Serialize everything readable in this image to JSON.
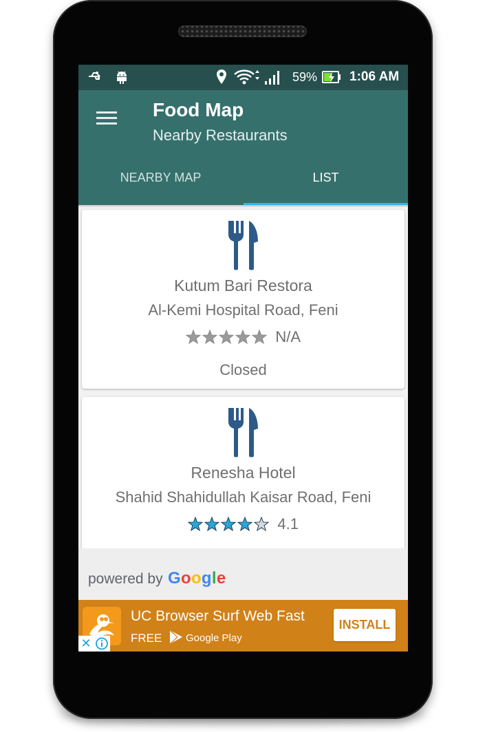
{
  "status_bar": {
    "battery_percent": "59%",
    "time": "1:06 AM",
    "icons": [
      "usb-icon",
      "android-debug-icon",
      "location-icon",
      "wifi-icon",
      "signal-icon",
      "battery-charging-icon"
    ]
  },
  "app_bar": {
    "title": "Food Map",
    "subtitle": "Nearby Restaurants",
    "menu_icon": "hamburger-menu-icon",
    "tabs": [
      {
        "label": "NEARBY MAP",
        "selected": false
      },
      {
        "label": "LIST",
        "selected": true
      }
    ]
  },
  "restaurants": [
    {
      "name": "Kutum Bari Restora",
      "address": "Al-Kemi Hospital Road, Feni",
      "rating": "N/A",
      "rating_stars": 0,
      "status": "Closed",
      "icon": "fork-knife-icon"
    },
    {
      "name": "Renesha Hotel",
      "address": "Shahid Shahidullah Kaisar Road, Feni",
      "rating": "4.1",
      "rating_stars": 4.1,
      "icon": "fork-knife-icon"
    }
  ],
  "footer": {
    "powered_by": "powered by",
    "google_letters": [
      "G",
      "o",
      "o",
      "g",
      "l",
      "e"
    ]
  },
  "ad": {
    "title": "UC Browser Surf Web Fast",
    "price": "FREE",
    "store": "Google Play",
    "install_label": "INSTALL",
    "close_label": "✕"
  },
  "colors": {
    "status_bar": "#264f4e",
    "app_bar": "#36706d",
    "tab_indicator": "#2fb6ea",
    "food_icon": "#2d5a88",
    "star_filled": "#2ba6d8",
    "star_empty": "#9a9a9a",
    "ad_background": "#d08118"
  }
}
